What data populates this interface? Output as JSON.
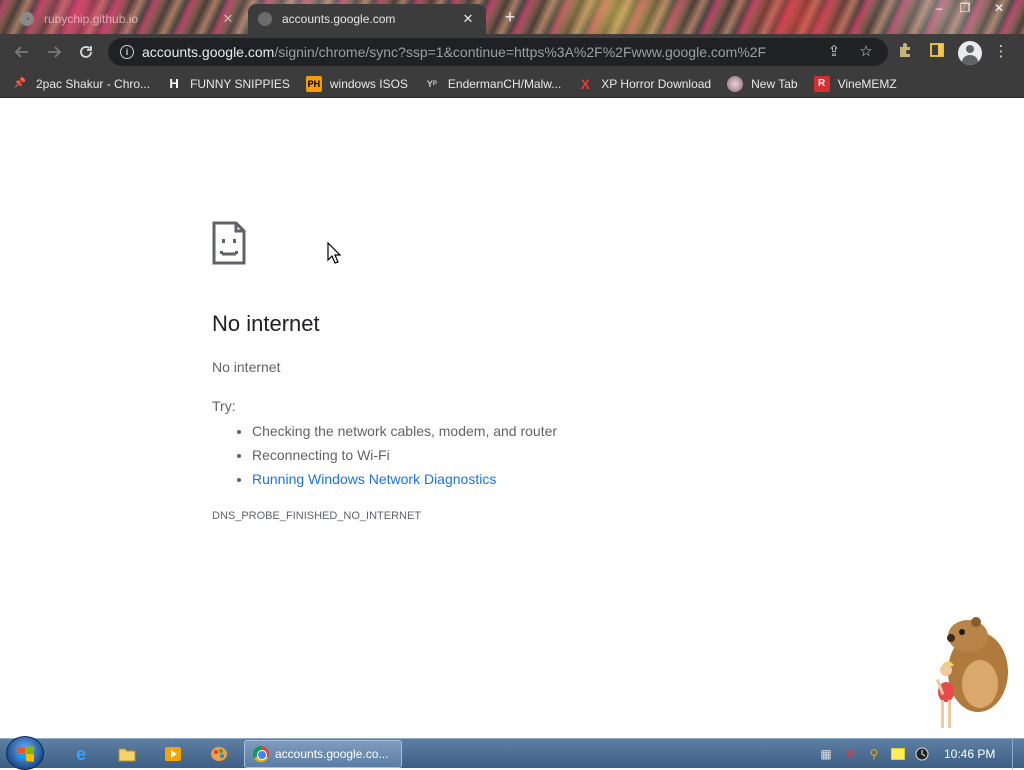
{
  "browser": {
    "tabs": [
      {
        "title": "rubychip.github.io",
        "active": false
      },
      {
        "title": "accounts.google.com",
        "active": true
      }
    ],
    "new_tab_symbol": "+",
    "window_controls": {
      "minimize": "–",
      "maximize": "❐",
      "close": "✕"
    },
    "address": {
      "host": "accounts.google.com",
      "path": "/signin/chrome/sync?ssp=1&continue=https%3A%2F%2Fwww.google.com%2F"
    },
    "toolbar_icons": [
      "back-icon",
      "forward-icon",
      "reload-icon",
      "info-icon",
      "share-icon",
      "star-icon",
      "extensions-icon",
      "side-panel-icon",
      "profile-icon",
      "menu-icon"
    ]
  },
  "bookmarks": [
    {
      "label": "2pac Shakur - Chro...",
      "icon": "pin-icon",
      "color": "#e8eaed"
    },
    {
      "label": "FUNNY SNIPPIES",
      "icon": "h-icon",
      "color": "#ffffff"
    },
    {
      "label": "windows ISOS",
      "icon": "ph-icon",
      "color": "#f59c0b"
    },
    {
      "label": "EndermanCH/Malw...",
      "icon": "yp-icon",
      "color": "#bbbbbb"
    },
    {
      "label": "XP Horror Download",
      "icon": "x-icon",
      "color": "#e53935"
    },
    {
      "label": "New Tab",
      "icon": "globe-icon",
      "color": "#c7a5a5"
    },
    {
      "label": "VineMEMZ",
      "icon": "r-icon",
      "color": "#d32f2f"
    }
  ],
  "error_page": {
    "title": "No internet",
    "subtitle": "No internet",
    "try_label": "Try:",
    "suggestions": [
      "Checking the network cables, modem, and router",
      "Reconnecting to Wi-Fi",
      "Running Windows Network Diagnostics"
    ],
    "error_code": "DNS_PROBE_FINISHED_NO_INTERNET"
  },
  "taskbar": {
    "pinned": [
      "ie-icon",
      "explorer-icon",
      "media-player-icon",
      "paint-icon"
    ],
    "active_window_title": "accounts.google.co...",
    "tray": [
      "network-tray-icon",
      "v-tray-icon",
      "search-tray-icon",
      "note-tray-icon",
      "clock-tray-icon"
    ],
    "clock": "10:46 PM"
  },
  "colors": {
    "toolbar_bg": "#3c3c3c",
    "link": "#1a73e8",
    "taskbar": "#4a6d95"
  }
}
